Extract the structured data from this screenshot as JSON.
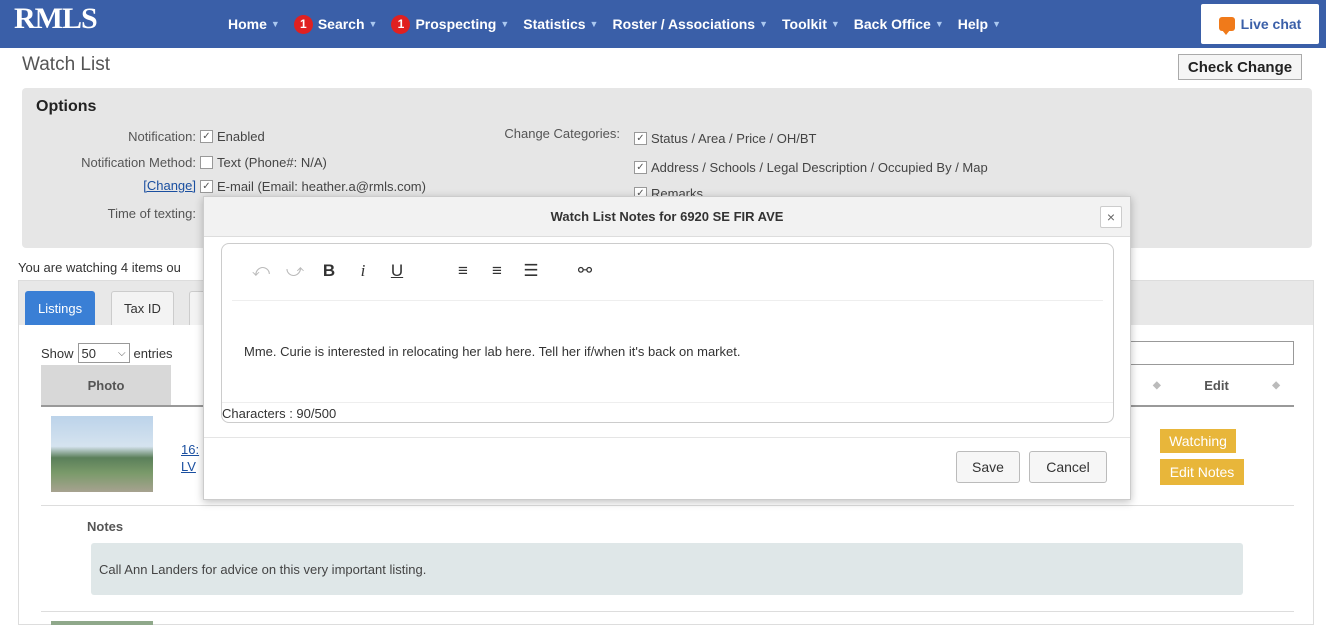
{
  "nav": {
    "logo": "RMLS",
    "items": [
      {
        "label": "Home",
        "badge": ""
      },
      {
        "label": "Search",
        "badge": "1"
      },
      {
        "label": "Prospecting",
        "badge": "1"
      },
      {
        "label": "Statistics",
        "badge": ""
      },
      {
        "label": "Roster / Associations",
        "badge": ""
      },
      {
        "label": "Toolkit",
        "badge": ""
      },
      {
        "label": "Back Office",
        "badge": ""
      },
      {
        "label": "Help",
        "badge": ""
      }
    ],
    "live_chat": "Live chat"
  },
  "page": {
    "title": "Watch List",
    "check_change": "Check Change",
    "watching_text": "You are watching 4 items ou"
  },
  "options": {
    "title": "Options",
    "notification_label": "Notification:",
    "notification_value": "Enabled",
    "method_label": "Notification Method:",
    "method_text": "Text (Phone#: N/A)",
    "change_link": "[Change]",
    "method_email": "E-mail (Email: heather.a@rmls.com)",
    "texting_label": "Time of texting:",
    "categories_label": "Change Categories:",
    "categories": [
      "Status / Area / Price / OH/BT",
      "Address / Schools / Legal Description / Occupied By / Map",
      "Remarks"
    ]
  },
  "tabs": [
    "Listings",
    "Tax ID"
  ],
  "table": {
    "show_label": "Show",
    "entries_value": "50",
    "entries_label": "entries",
    "col_photo": "Photo",
    "col_edit": "Edit",
    "row_link_line1": "16:",
    "row_link_line2": "LV",
    "watching_btn": "Watching",
    "edit_notes_btn": "Edit Notes",
    "notes_label": "Notes",
    "notes_text": "Call Ann Landers for advice on this very important listing."
  },
  "modal": {
    "title": "Watch List Notes for 6920 SE FIR AVE",
    "close": "×",
    "toolbar": {
      "undo": "⤺",
      "redo": "⤻",
      "bold": "B",
      "italic": "i",
      "underline": "U",
      "align_left": "≡",
      "align_center": "≡",
      "list": "☰",
      "link": "⚯"
    },
    "body_text": "Mme. Curie is interested in relocating her lab here. Tell her if/when it's back on market.",
    "char_count": "Characters : 90/500",
    "save": "Save",
    "cancel": "Cancel"
  },
  "colors": {
    "nav_bg": "#3a5fa8",
    "tab_active": "#3a7fd5",
    "gold_button": "#e8b63a",
    "badge": "#e02020"
  }
}
